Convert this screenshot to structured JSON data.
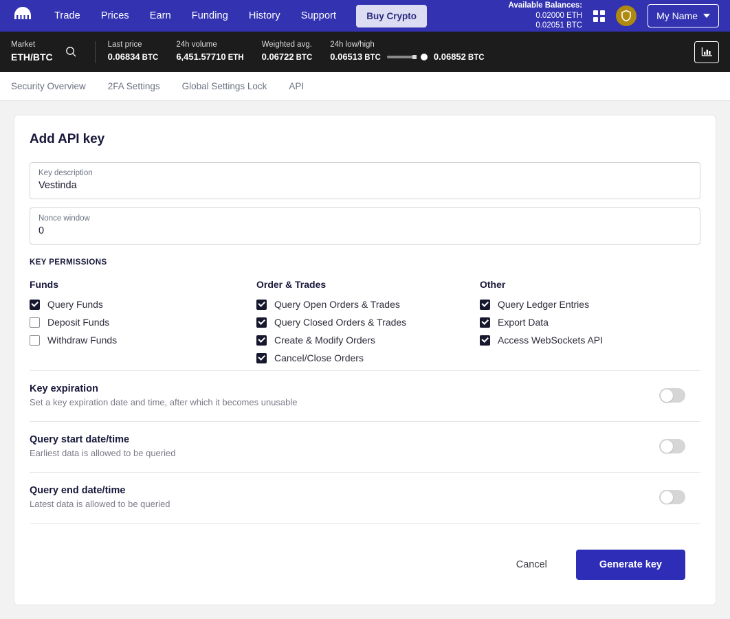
{
  "topnav": {
    "logo_icon": "kraken-squid-logo",
    "links": [
      {
        "label": "Trade"
      },
      {
        "label": "Prices"
      },
      {
        "label": "Earn"
      },
      {
        "label": "Funding"
      },
      {
        "label": "History"
      },
      {
        "label": "Support"
      }
    ],
    "buy_crypto_label": "Buy Crypto",
    "balances": {
      "title": "Available Balances:",
      "rows": [
        "0.02000 ETH",
        "0.02051 BTC"
      ]
    },
    "grid_icon": "grid-apps-icon",
    "shield_icon": "shield-security-icon",
    "user_label": "My Name",
    "caret_icon": "chevron-down-icon",
    "accent_color": "#3333b2",
    "buy_crypto_bg": "#dcdcf2",
    "shield_bg": "#b08910"
  },
  "marketbar": {
    "market_label": "Market",
    "market_value": "ETH/BTC",
    "search_icon": "search-icon",
    "chart_icon": "bar-chart-icon",
    "stats": [
      {
        "label": "Last price",
        "value": "0.06834",
        "unit": "BTC"
      },
      {
        "label": "24h volume",
        "value": "6,451.57710",
        "unit": "ETH"
      },
      {
        "label": "Weighted avg.",
        "value": "0.06722",
        "unit": "BTC"
      }
    ],
    "range": {
      "label": "24h low/high",
      "low_value": "0.06513",
      "low_unit": "BTC",
      "high_value": "0.06852",
      "high_unit": "BTC"
    },
    "bg_color": "#1c1c1c"
  },
  "tabs": [
    {
      "label": "Security Overview"
    },
    {
      "label": "2FA Settings"
    },
    {
      "label": "Global Settings Lock"
    },
    {
      "label": "API"
    }
  ],
  "card": {
    "title": "Add API key",
    "fields": [
      {
        "label": "Key description",
        "value": "Vestinda",
        "placeholder": "Key description"
      },
      {
        "label": "Nonce window",
        "value": "0",
        "placeholder": "Nonce window"
      }
    ],
    "permissions_title": "KEY PERMISSIONS",
    "permission_groups": [
      {
        "heading": "Funds",
        "items": [
          {
            "label": "Query Funds",
            "checked": true
          },
          {
            "label": "Deposit Funds",
            "checked": false
          },
          {
            "label": "Withdraw Funds",
            "checked": false
          }
        ]
      },
      {
        "heading": "Order & Trades",
        "items": [
          {
            "label": "Query Open Orders & Trades",
            "checked": true
          },
          {
            "label": "Query Closed Orders & Trades",
            "checked": true
          },
          {
            "label": "Create & Modify Orders",
            "checked": true
          },
          {
            "label": "Cancel/Close Orders",
            "checked": true
          }
        ]
      },
      {
        "heading": "Other",
        "items": [
          {
            "label": "Query Ledger Entries",
            "checked": true
          },
          {
            "label": "Export Data",
            "checked": true
          },
          {
            "label": "Access WebSockets API",
            "checked": true
          }
        ]
      }
    ],
    "toggle_rows": [
      {
        "title": "Key expiration",
        "subtitle": "Set a key expiration date and time, after which it becomes unusable",
        "enabled": false
      },
      {
        "title": "Query start date/time",
        "subtitle": "Earliest data is allowed to be queried",
        "enabled": false
      },
      {
        "title": "Query end date/time",
        "subtitle": "Latest data is allowed to be queried",
        "enabled": false
      }
    ],
    "cancel_label": "Cancel",
    "submit_label": "Generate key",
    "submit_color": "#2d2db8"
  }
}
